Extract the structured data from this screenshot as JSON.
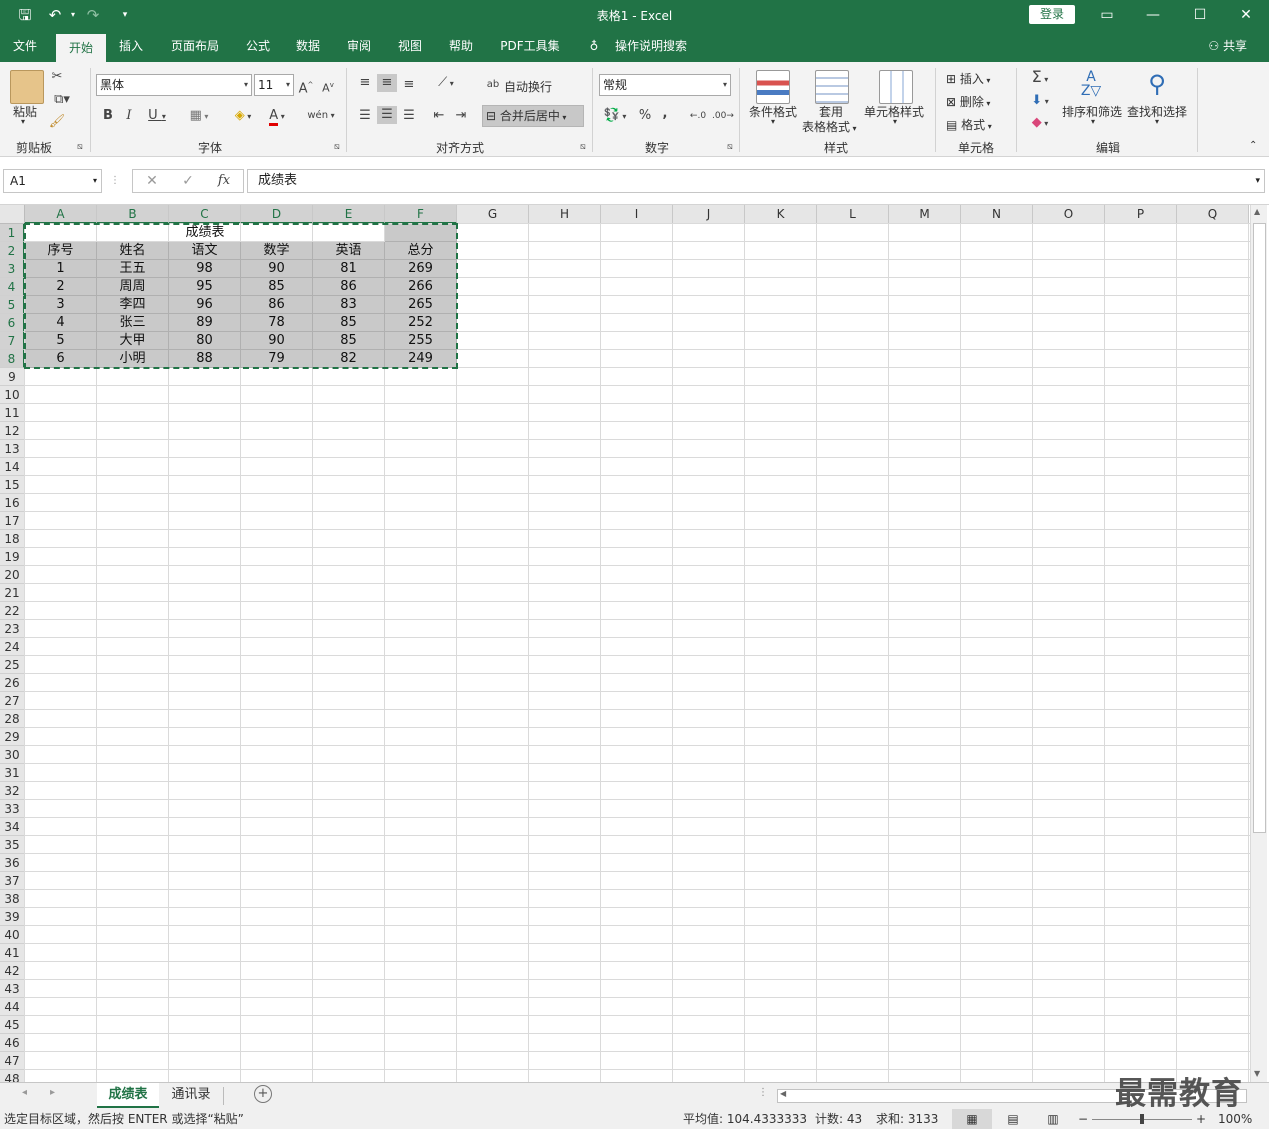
{
  "app": {
    "title": "表格1  -  Excel",
    "login": "登录"
  },
  "menu": {
    "tabs": [
      "文件",
      "开始",
      "插入",
      "页面布局",
      "公式",
      "数据",
      "审阅",
      "视图",
      "帮助",
      "PDF工具集"
    ],
    "tell_me": "操作说明搜索",
    "share": "共享"
  },
  "ribbon": {
    "paste_label": "粘贴",
    "font_name": "黑体",
    "font_size": "11",
    "wrap_text": "自动换行",
    "merge_center": "合并后居中",
    "number_format": "常规",
    "cond_format": "条件格式",
    "table_format_1": "套用",
    "table_format_2": "表格格式",
    "cell_styles": "单元格样式",
    "insert": "插入",
    "delete": "删除",
    "format": "格式",
    "sort_filter": "排序和筛选",
    "find_select": "查找和选择",
    "groups": [
      "剪贴板",
      "字体",
      "对齐方式",
      "数字",
      "样式",
      "单元格",
      "编辑"
    ]
  },
  "formula": {
    "name_box": "A1",
    "fx": "fx",
    "content": "成绩表"
  },
  "sheet": {
    "columns": [
      "A",
      "B",
      "C",
      "D",
      "E",
      "F",
      "G",
      "H",
      "I",
      "J",
      "K",
      "L",
      "M",
      "N",
      "O",
      "P",
      "Q"
    ],
    "row_count": 48,
    "table_title": "成绩表",
    "headers": [
      "序号",
      "姓名",
      "语文",
      "数学",
      "英语",
      "总分"
    ],
    "rows": [
      [
        "1",
        "王五",
        "98",
        "90",
        "81",
        "269"
      ],
      [
        "2",
        "周周",
        "95",
        "85",
        "86",
        "266"
      ],
      [
        "3",
        "李四",
        "96",
        "86",
        "83",
        "265"
      ],
      [
        "4",
        "张三",
        "89",
        "78",
        "85",
        "252"
      ],
      [
        "5",
        "大甲",
        "80",
        "90",
        "85",
        "255"
      ],
      [
        "6",
        "小明",
        "88",
        "79",
        "82",
        "249"
      ]
    ]
  },
  "tabs": [
    "成绩表",
    "通讯录"
  ],
  "status": {
    "message": "选定目标区域，然后按 ENTER 或选择“粘贴”",
    "average": "平均值: 104.4333333",
    "count": "计数: 43",
    "sum": "求和: 3133",
    "zoom": "100%"
  },
  "watermark": "最需教育"
}
